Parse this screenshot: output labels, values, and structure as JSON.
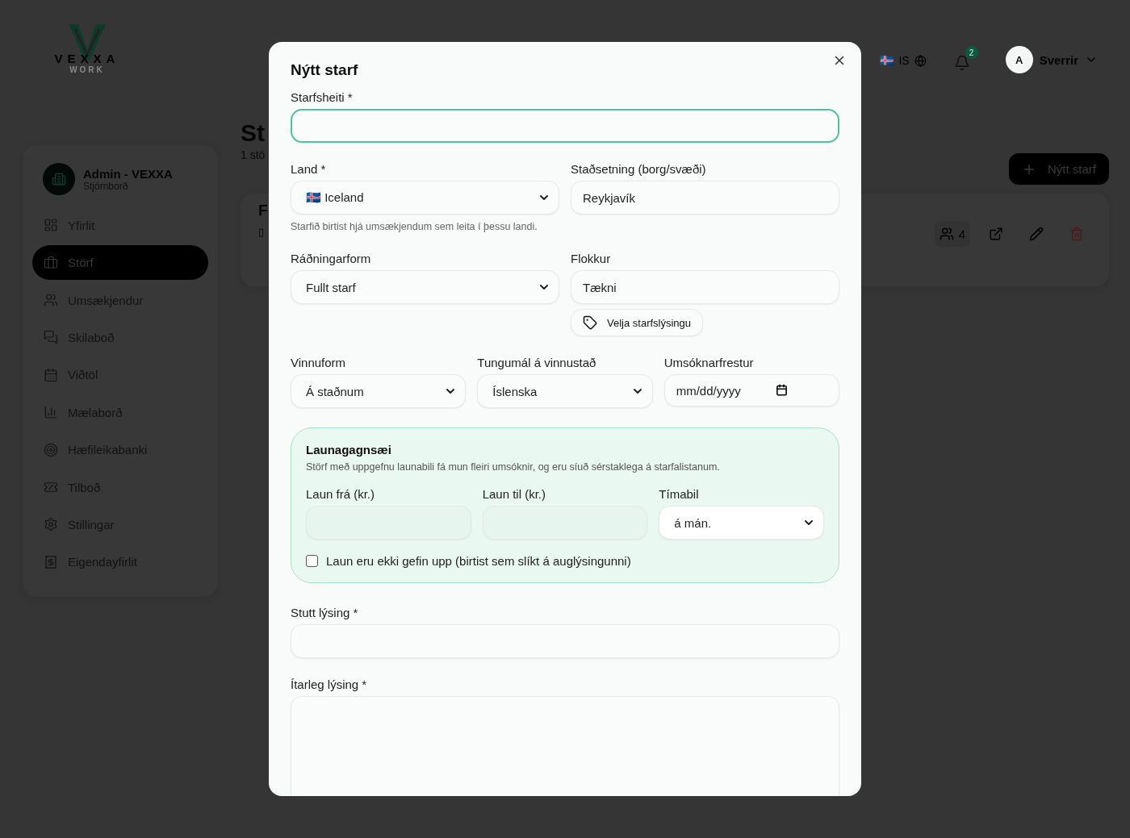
{
  "logo": {
    "name": "VEXXA",
    "tagline": "WORK"
  },
  "topbar": {
    "flag": "🇮🇸",
    "language": "IS",
    "notifications": "2",
    "avatar": "A",
    "user": "Sverrir"
  },
  "sidebar": {
    "org": "Admin - VEXXA",
    "role": "Stjórnborð",
    "items": [
      {
        "label": "Yfirlit",
        "selected": false
      },
      {
        "label": "Störf",
        "selected": true
      },
      {
        "label": "Umsækjendur",
        "selected": false
      },
      {
        "label": "Skilaboð",
        "selected": false
      },
      {
        "label": "Viðtöl",
        "selected": false
      },
      {
        "label": "Mælaborð",
        "selected": false
      },
      {
        "label": "Hæfileikabanki",
        "selected": false
      },
      {
        "label": "Tilboð",
        "selected": false
      },
      {
        "label": "Stillingar",
        "selected": false
      },
      {
        "label": "Eigendayfirlit",
        "selected": false
      }
    ]
  },
  "page": {
    "title": "St",
    "subtitle": "1 stö",
    "new_button": "Nýtt starf",
    "job": {
      "title": "F",
      "subtitle": "▯",
      "applicants": "4"
    }
  },
  "modal": {
    "title": "Nýtt starf",
    "rows": [
      [
        {
          "kind": "text",
          "label": "Starfsheiti *",
          "focused": true
        }
      ],
      [
        {
          "kind": "select",
          "label": "Land *",
          "value": "🇮🇸 Iceland",
          "hint": "Starfið birtist hjá umsækjendum sem leita í þessu landi."
        },
        {
          "kind": "text",
          "label": "Staðsetning (borg/svæði)",
          "value": "Reykjavík",
          "focused": false
        }
      ],
      [
        {
          "kind": "select",
          "label": "Ráðningarform",
          "value": "Fullt starf"
        },
        {
          "kind": "text",
          "label": "Flokkur",
          "value": "Tækni",
          "focused": false,
          "action": "Velja starfslýsingu"
        }
      ],
      [
        {
          "kind": "select",
          "label": "Vinnuform",
          "value": "Á staðnum"
        },
        {
          "kind": "select",
          "label": "Tungumál á vinnustað",
          "value": "Íslenska"
        },
        {
          "kind": "date",
          "label": "Umsóknarfrestur",
          "placeholder": "mm/dd/yyyy"
        }
      ]
    ],
    "salary": {
      "title": "Launagagnsæi",
      "note": "Störf með uppgefnu launabili fá mun fleiri umsóknir, og eru síuð sérstaklega á starfalistanum.",
      "fields": [
        {
          "kind": "text",
          "label": "Laun frá (kr.)",
          "focused": false
        },
        {
          "kind": "text",
          "label": "Laun til (kr.)",
          "focused": false
        },
        {
          "kind": "select",
          "label": "Tímabil",
          "value": "á mán."
        }
      ],
      "hidden_checkbox": {
        "label": "Laun eru ekki gefin upp (birtist sem slíkt á auglýsingunni)",
        "checked": false
      }
    },
    "descriptions": [
      {
        "kind": "text",
        "label": "Stutt lýsing *",
        "focused": false
      },
      {
        "kind": "textarea",
        "label": "Ítarleg lýsing *",
        "focused": false
      }
    ]
  }
}
